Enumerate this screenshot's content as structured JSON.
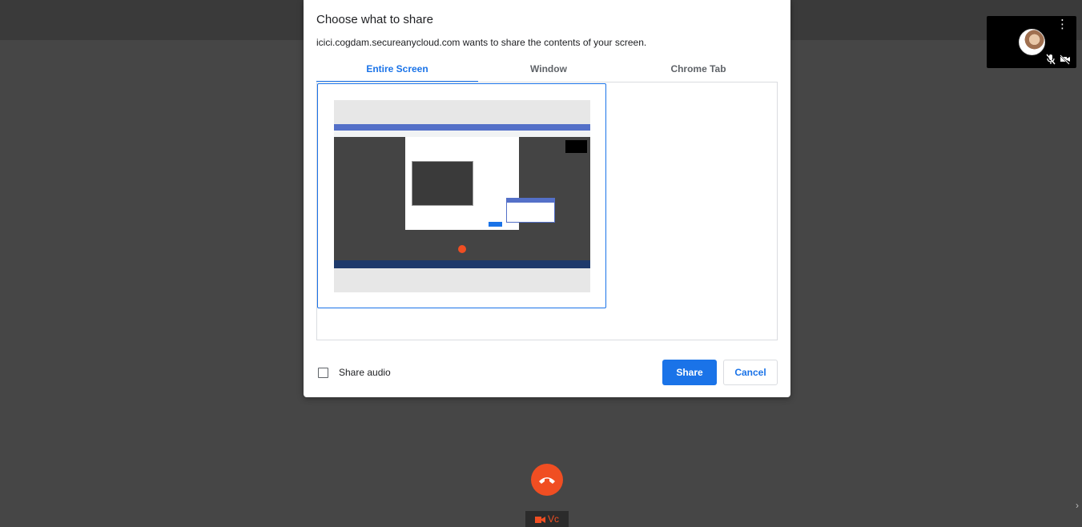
{
  "dialog": {
    "title": "Choose what to share",
    "subtitle": "icici.cogdam.secureanycloud.com wants to share the contents of your screen.",
    "tabs": [
      {
        "label": "Entire Screen",
        "active": true
      },
      {
        "label": "Window",
        "active": false
      },
      {
        "label": "Chrome Tab",
        "active": false
      }
    ],
    "share_audio_label": "Share audio",
    "share_audio_checked": false,
    "share_button": "Share",
    "cancel_button": "Cancel"
  },
  "call": {
    "badge_label": "Vc",
    "accent_color": "#f04e22",
    "icons": [
      "more-vert-icon",
      "mic-off-icon",
      "camera-off-icon",
      "phone-hangup-icon",
      "video-camera-icon"
    ]
  },
  "colors": {
    "primary": "#1a73e8",
    "background": "#464646"
  }
}
